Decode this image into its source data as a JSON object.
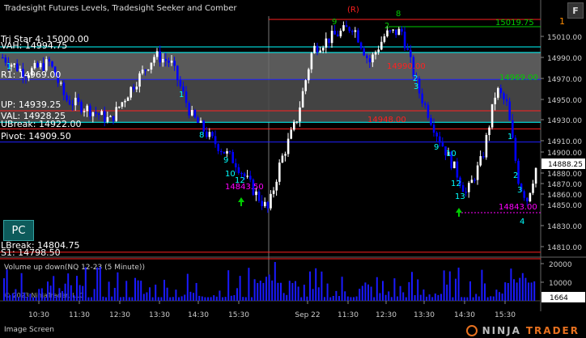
{
  "title": "Tradesight Futures Levels, Tradesight Seeker and Comber",
  "buttons": {
    "f": "F",
    "pc": "PC"
  },
  "colors": {
    "background": "#000000",
    "up_candle": "#ffffff",
    "down_candle": "#0000ff",
    "cyan": "#00ffff",
    "green": "#00cc00",
    "red": "#ff2020",
    "magenta": "#ff00ff",
    "blue_level": "#2020ff",
    "gray_zone": "#555555",
    "volume": "#1a1aff"
  },
  "levels": [
    {
      "name": "Tri Star 4",
      "label": "Tri Star 4: 15000.00",
      "price": 15000.0
    },
    {
      "name": "VAH",
      "label": "VAH: 14994.75",
      "price": 14994.75
    },
    {
      "name": "R1",
      "label": "R1: 14969.00",
      "price": 14969.0
    },
    {
      "name": "UP",
      "label": "UP: 14939.25",
      "price": 14939.25
    },
    {
      "name": "VAL",
      "label": "VAL: 14928.25",
      "price": 14928.25
    },
    {
      "name": "UBreak",
      "label": "UBreak: 14922.00",
      "price": 14922.0
    },
    {
      "name": "Pivot",
      "label": "Pivot: 14909.50",
      "price": 14909.5
    },
    {
      "name": "LBreak",
      "label": "LBreak: 14804.75",
      "price": 14804.75
    },
    {
      "name": "S1",
      "label": "S1: 14798.50",
      "price": 14798.5
    }
  ],
  "annotations": {
    "r_marker": "(R)",
    "level_15019": "15019.75",
    "level_14990": "14990.00",
    "level_14969": "14969.00",
    "level_14948": "14948.00",
    "low1": "14843.50",
    "low2": "14843.00",
    "num_1": "1",
    "num_2": "2",
    "num_3": "3",
    "num_4": "4",
    "num_8": "8",
    "num_9": "9",
    "num_10": "10",
    "num_12": "12",
    "num_13": "13"
  },
  "price_axis": {
    "ticks": [
      "15010.00",
      "14990.00",
      "14970.00",
      "14950.00",
      "14930.00",
      "14910.00",
      "14900.00",
      "14880.00",
      "14870.00",
      "14860.00",
      "14850.00",
      "14830.00",
      "14810.00"
    ],
    "current": "14888.25"
  },
  "time_axis": {
    "ticks": [
      "10:30",
      "11:30",
      "12:30",
      "13:30",
      "14:30",
      "15:30",
      "Sep 22",
      "11:30",
      "12:30",
      "13:30",
      "14:30",
      "15:30"
    ]
  },
  "volume_panel": {
    "label": "Volume up down(NQ 12-23 (5 Minute))",
    "ticks": [
      "20000",
      "10000"
    ],
    "current": "1664"
  },
  "copyright": "© 2023 NinjaTrader, LLC",
  "footer": {
    "label": "Image Screen",
    "logo_ninja": "NINJA",
    "logo_trader": "TRADER"
  }
}
